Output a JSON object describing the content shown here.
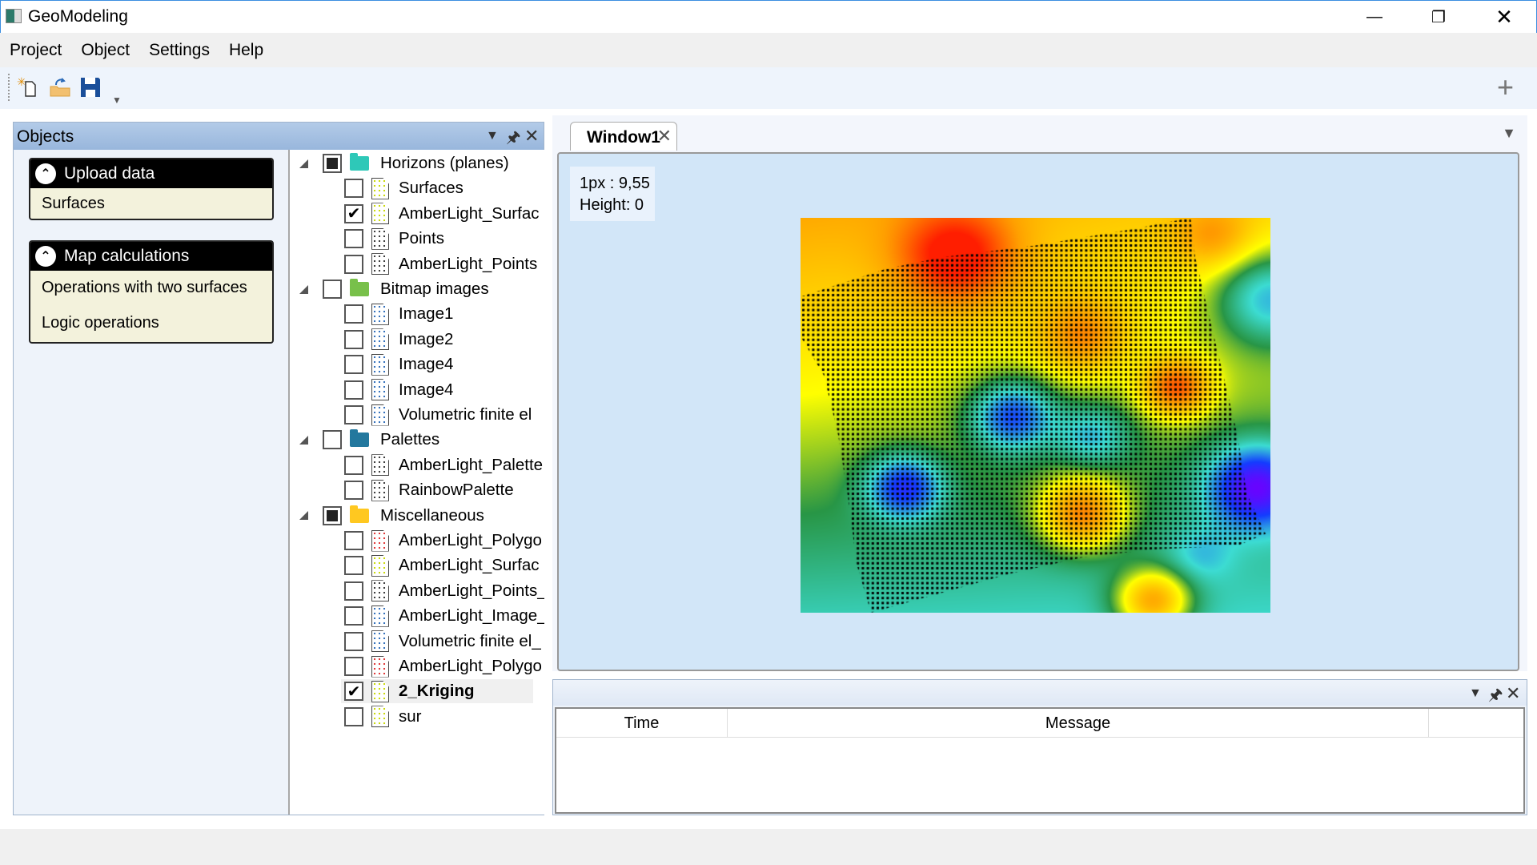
{
  "window": {
    "title": "GeoModeling",
    "minimize_icon": "minimize-icon",
    "restore_icon": "restore-icon",
    "close_icon": "close-icon"
  },
  "menu": [
    "Project",
    "Object",
    "Settings",
    "Help"
  ],
  "toolbar": {
    "buttons": [
      {
        "name": "new-project",
        "icon": "new-file-icon"
      },
      {
        "name": "open-project",
        "icon": "open-folder-icon"
      },
      {
        "name": "save-project",
        "icon": "save-icon"
      }
    ],
    "add_icon": "plus-icon"
  },
  "objects_panel": {
    "title": "Objects",
    "accordions": [
      {
        "title": "Upload data",
        "items": [
          "Surfaces"
        ]
      },
      {
        "title": "Map calculations",
        "items": [
          "Operations with two surfaces",
          "Logic operations"
        ]
      }
    ],
    "tree": [
      {
        "label": "Horizons (planes)",
        "state": "indeterminate",
        "folder_color": "#2ec8b8",
        "children": [
          {
            "label": "Surfaces",
            "checked": false,
            "dot": "#c8d800"
          },
          {
            "label": "AmberLight_Surfac",
            "checked": true,
            "dot": "#c8d800"
          },
          {
            "label": "Points",
            "checked": false,
            "dot": "#333333"
          },
          {
            "label": "AmberLight_Points",
            "checked": false,
            "dot": "#333333"
          }
        ]
      },
      {
        "label": "Bitmap images",
        "state": "unchecked",
        "folder_color": "#78c04a",
        "children": [
          {
            "label": "Image1",
            "checked": false,
            "dot": "#2a6ab8"
          },
          {
            "label": "Image2",
            "checked": false,
            "dot": "#2a6ab8"
          },
          {
            "label": "Image4",
            "checked": false,
            "dot": "#2a6ab8"
          },
          {
            "label": "Image4",
            "checked": false,
            "dot": "#2a6ab8"
          },
          {
            "label": "Volumetric finite el",
            "checked": false,
            "dot": "#2a6ab8"
          }
        ]
      },
      {
        "label": "Palettes",
        "state": "unchecked",
        "folder_color": "#23789e",
        "children": [
          {
            "label": "AmberLight_Palette",
            "checked": false,
            "dot": "#333333"
          },
          {
            "label": "RainbowPalette",
            "checked": false,
            "dot": "#333333"
          }
        ]
      },
      {
        "label": "Miscellaneous",
        "state": "indeterminate",
        "folder_color": "#ffc820",
        "children": [
          {
            "label": "AmberLight_Polygo",
            "checked": false,
            "dot": "#e03030"
          },
          {
            "label": "AmberLight_Surfac",
            "checked": false,
            "dot": "#c8d800"
          },
          {
            "label": "AmberLight_Points_",
            "checked": false,
            "dot": "#333333"
          },
          {
            "label": "AmberLight_Image_",
            "checked": false,
            "dot": "#2a6ab8"
          },
          {
            "label": "Volumetric finite el_",
            "checked": false,
            "dot": "#2a6ab8"
          },
          {
            "label": "AmberLight_Polygo",
            "checked": false,
            "dot": "#e03030"
          },
          {
            "label": "2_Kriging",
            "checked": true,
            "selected": true,
            "dot": "#c8d800"
          },
          {
            "label": "sur",
            "checked": false,
            "dot": "#c8d800"
          }
        ]
      }
    ]
  },
  "document": {
    "tab": "Window1",
    "scale": "1px : 9,55",
    "height": "Height: 0"
  },
  "log_panel": {
    "columns": [
      "Time",
      "Message"
    ]
  }
}
